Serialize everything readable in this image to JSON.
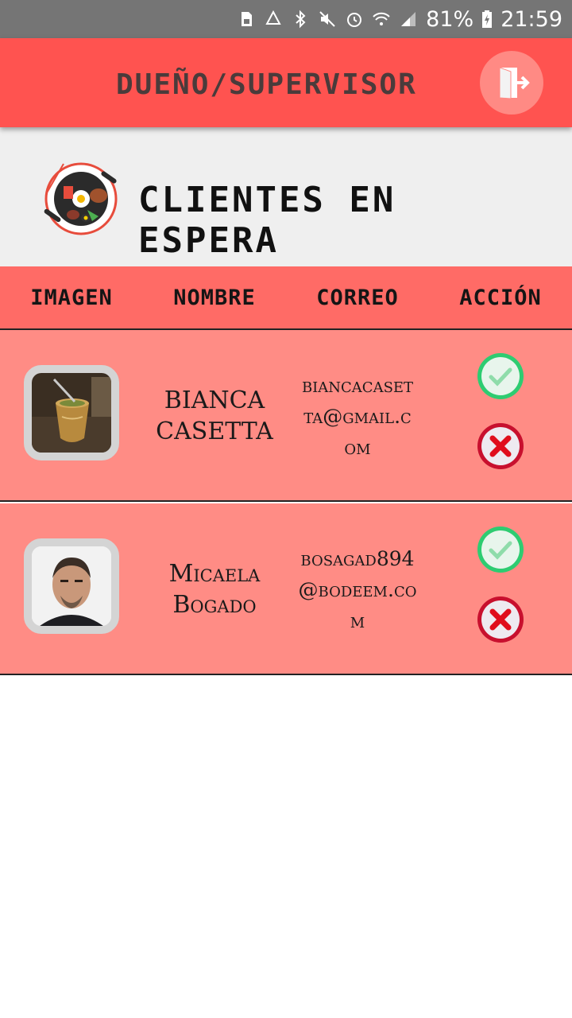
{
  "status_bar": {
    "battery": "81%",
    "time": "21:59"
  },
  "app_bar": {
    "title": "Dueño/Supervisor",
    "logout_icon": "logout-door-icon"
  },
  "header": {
    "title": "Clientes en espera",
    "logo_icon": "food-pan-logo"
  },
  "table": {
    "columns": [
      "Imagen",
      "Nombre",
      "Correo",
      "Acción"
    ],
    "rows": [
      {
        "image_icon": "mate-cup-photo",
        "name": "BIANCA CASETTA",
        "email": "biancacasetta@gmail.com"
      },
      {
        "image_icon": "man-portrait-photo",
        "name": "Micaela Bogado",
        "email": "bosagad894@bodeem.com"
      }
    ]
  },
  "colors": {
    "status_bar": "#757575",
    "app_bar": "#ff5350",
    "header_bg": "#efefef",
    "table_header": "#ff6b66",
    "row_bg": "#ff8c85",
    "accept": "#2ecc71",
    "reject": "#d9101e"
  }
}
